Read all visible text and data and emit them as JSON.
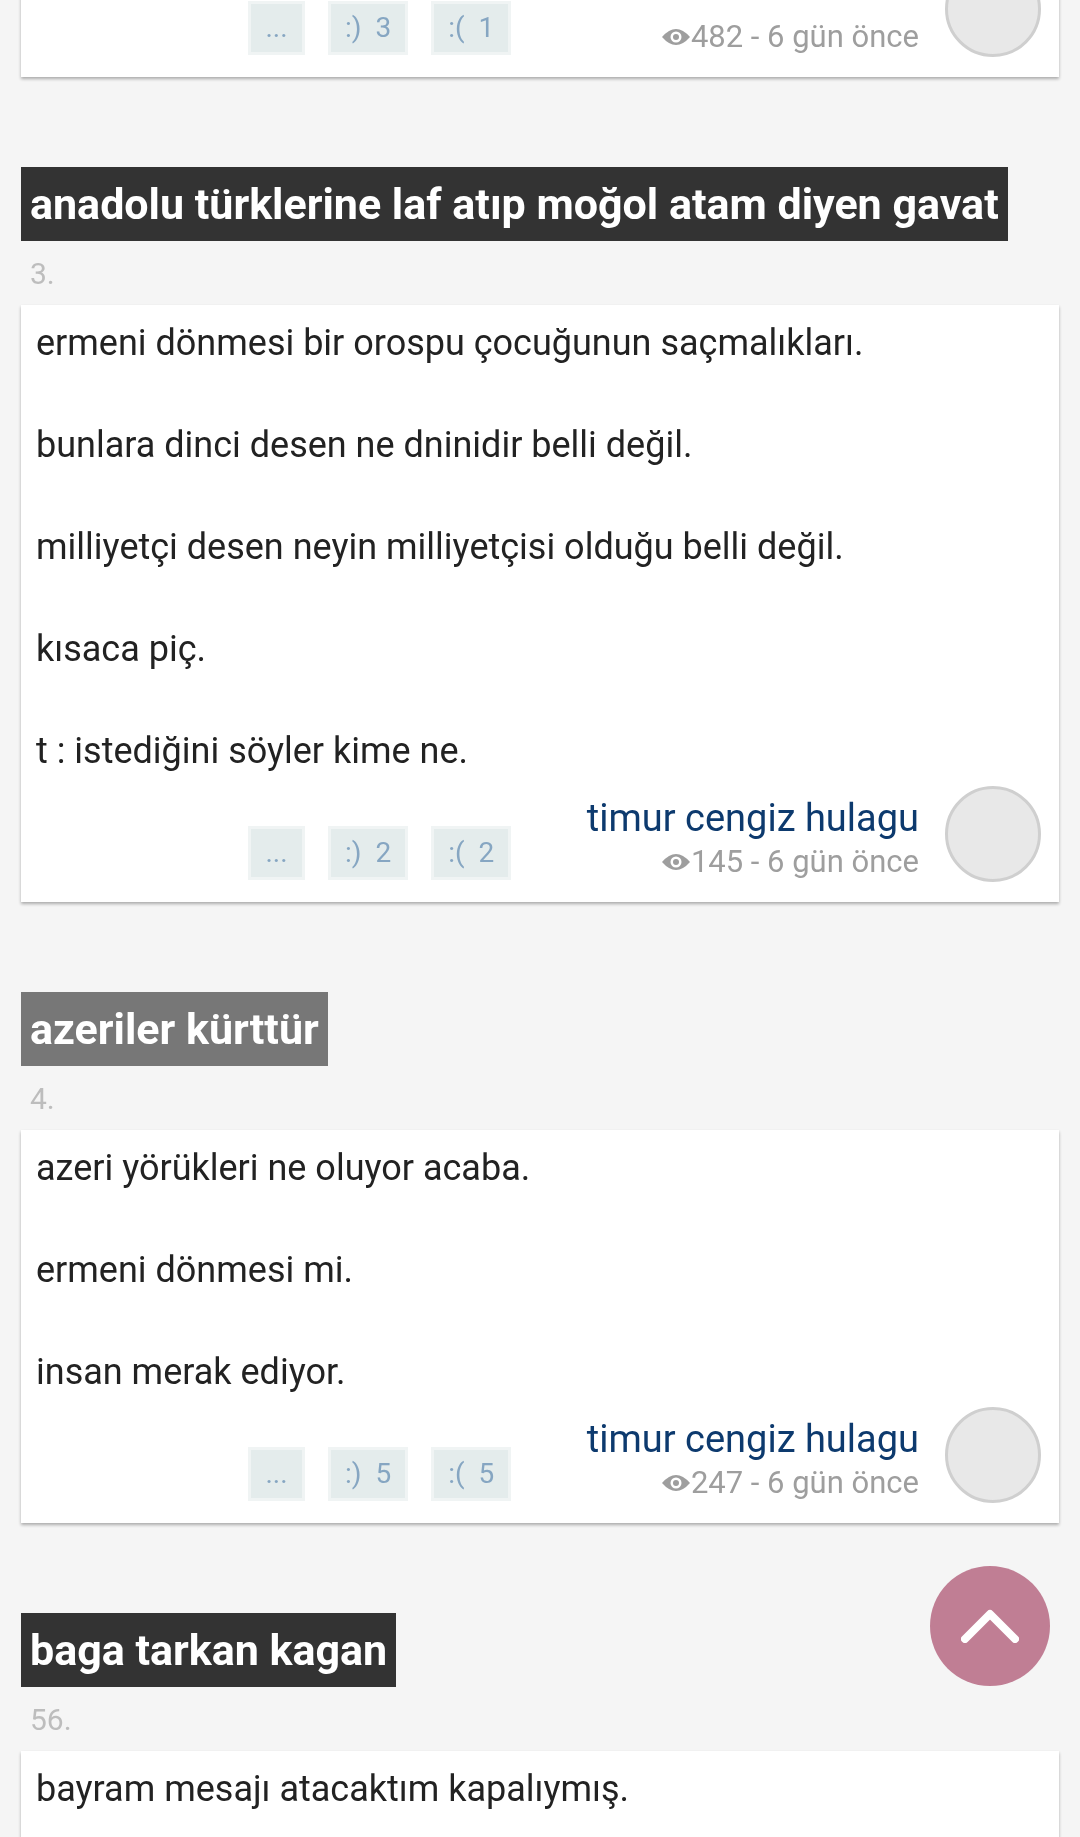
{
  "entries": [
    {
      "reactions": [
        {
          "face": "..."
        },
        {
          "face": ":)",
          "count": "3"
        },
        {
          "face": ":(",
          "count": "1"
        }
      ],
      "meta": "482 - 6 gün önce"
    },
    {
      "title": "anadolu türklerine laf atıp moğol atam diyen gavat",
      "color": "#333333",
      "number": "3.",
      "paragraphs": [
        "ermeni dönmesi bir orospu çocuğunun saçmalıkları.",
        "bunlara dinci desen ne dninidir belli değil.",
        "milliyetçi desen neyin milliyetçisi olduğu belli değil.",
        "kısaca piç.",
        "t : istediğini söyler kime ne."
      ],
      "author": "timur cengiz hulagu",
      "reactions": [
        {
          "face": "..."
        },
        {
          "face": ":)",
          "count": "2"
        },
        {
          "face": ":(",
          "count": "2"
        }
      ],
      "meta": "145 - 6 gün önce"
    },
    {
      "title": "azeriler kürttür",
      "color": "#777777",
      "number": "4.",
      "paragraphs": [
        "azeri yörükleri ne oluyor acaba.",
        "ermeni dönmesi mi.",
        "insan merak ediyor."
      ],
      "author": "timur cengiz hulagu",
      "reactions": [
        {
          "face": "..."
        },
        {
          "face": ":)",
          "count": "5"
        },
        {
          "face": ":(",
          "count": "5"
        }
      ],
      "meta": "247 - 6 gün önce"
    },
    {
      "title": "baga tarkan kagan",
      "color": "#333333",
      "number": "56.",
      "paragraphs": [
        "bayram mesajı atacaktım kapalıymış."
      ]
    }
  ]
}
